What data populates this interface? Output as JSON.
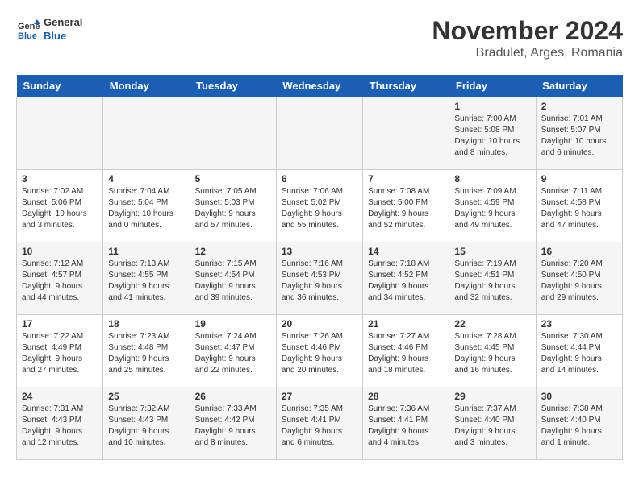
{
  "logo": {
    "line1": "General",
    "line2": "Blue"
  },
  "title": "November 2024",
  "subtitle": "Bradulet, Arges, Romania",
  "days_of_week": [
    "Sunday",
    "Monday",
    "Tuesday",
    "Wednesday",
    "Thursday",
    "Friday",
    "Saturday"
  ],
  "weeks": [
    [
      {
        "day": "",
        "info": ""
      },
      {
        "day": "",
        "info": ""
      },
      {
        "day": "",
        "info": ""
      },
      {
        "day": "",
        "info": ""
      },
      {
        "day": "",
        "info": ""
      },
      {
        "day": "1",
        "info": "Sunrise: 7:00 AM\nSunset: 5:08 PM\nDaylight: 10 hours\nand 8 minutes."
      },
      {
        "day": "2",
        "info": "Sunrise: 7:01 AM\nSunset: 5:07 PM\nDaylight: 10 hours\nand 6 minutes."
      }
    ],
    [
      {
        "day": "3",
        "info": "Sunrise: 7:02 AM\nSunset: 5:06 PM\nDaylight: 10 hours\nand 3 minutes."
      },
      {
        "day": "4",
        "info": "Sunrise: 7:04 AM\nSunset: 5:04 PM\nDaylight: 10 hours\nand 0 minutes."
      },
      {
        "day": "5",
        "info": "Sunrise: 7:05 AM\nSunset: 5:03 PM\nDaylight: 9 hours\nand 57 minutes."
      },
      {
        "day": "6",
        "info": "Sunrise: 7:06 AM\nSunset: 5:02 PM\nDaylight: 9 hours\nand 55 minutes."
      },
      {
        "day": "7",
        "info": "Sunrise: 7:08 AM\nSunset: 5:00 PM\nDaylight: 9 hours\nand 52 minutes."
      },
      {
        "day": "8",
        "info": "Sunrise: 7:09 AM\nSunset: 4:59 PM\nDaylight: 9 hours\nand 49 minutes."
      },
      {
        "day": "9",
        "info": "Sunrise: 7:11 AM\nSunset: 4:58 PM\nDaylight: 9 hours\nand 47 minutes."
      }
    ],
    [
      {
        "day": "10",
        "info": "Sunrise: 7:12 AM\nSunset: 4:57 PM\nDaylight: 9 hours\nand 44 minutes."
      },
      {
        "day": "11",
        "info": "Sunrise: 7:13 AM\nSunset: 4:55 PM\nDaylight: 9 hours\nand 41 minutes."
      },
      {
        "day": "12",
        "info": "Sunrise: 7:15 AM\nSunset: 4:54 PM\nDaylight: 9 hours\nand 39 minutes."
      },
      {
        "day": "13",
        "info": "Sunrise: 7:16 AM\nSunset: 4:53 PM\nDaylight: 9 hours\nand 36 minutes."
      },
      {
        "day": "14",
        "info": "Sunrise: 7:18 AM\nSunset: 4:52 PM\nDaylight: 9 hours\nand 34 minutes."
      },
      {
        "day": "15",
        "info": "Sunrise: 7:19 AM\nSunset: 4:51 PM\nDaylight: 9 hours\nand 32 minutes."
      },
      {
        "day": "16",
        "info": "Sunrise: 7:20 AM\nSunset: 4:50 PM\nDaylight: 9 hours\nand 29 minutes."
      }
    ],
    [
      {
        "day": "17",
        "info": "Sunrise: 7:22 AM\nSunset: 4:49 PM\nDaylight: 9 hours\nand 27 minutes."
      },
      {
        "day": "18",
        "info": "Sunrise: 7:23 AM\nSunset: 4:48 PM\nDaylight: 9 hours\nand 25 minutes."
      },
      {
        "day": "19",
        "info": "Sunrise: 7:24 AM\nSunset: 4:47 PM\nDaylight: 9 hours\nand 22 minutes."
      },
      {
        "day": "20",
        "info": "Sunrise: 7:26 AM\nSunset: 4:46 PM\nDaylight: 9 hours\nand 20 minutes."
      },
      {
        "day": "21",
        "info": "Sunrise: 7:27 AM\nSunset: 4:46 PM\nDaylight: 9 hours\nand 18 minutes."
      },
      {
        "day": "22",
        "info": "Sunrise: 7:28 AM\nSunset: 4:45 PM\nDaylight: 9 hours\nand 16 minutes."
      },
      {
        "day": "23",
        "info": "Sunrise: 7:30 AM\nSunset: 4:44 PM\nDaylight: 9 hours\nand 14 minutes."
      }
    ],
    [
      {
        "day": "24",
        "info": "Sunrise: 7:31 AM\nSunset: 4:43 PM\nDaylight: 9 hours\nand 12 minutes."
      },
      {
        "day": "25",
        "info": "Sunrise: 7:32 AM\nSunset: 4:43 PM\nDaylight: 9 hours\nand 10 minutes."
      },
      {
        "day": "26",
        "info": "Sunrise: 7:33 AM\nSunset: 4:42 PM\nDaylight: 9 hours\nand 8 minutes."
      },
      {
        "day": "27",
        "info": "Sunrise: 7:35 AM\nSunset: 4:41 PM\nDaylight: 9 hours\nand 6 minutes."
      },
      {
        "day": "28",
        "info": "Sunrise: 7:36 AM\nSunset: 4:41 PM\nDaylight: 9 hours\nand 4 minutes."
      },
      {
        "day": "29",
        "info": "Sunrise: 7:37 AM\nSunset: 4:40 PM\nDaylight: 9 hours\nand 3 minutes."
      },
      {
        "day": "30",
        "info": "Sunrise: 7:38 AM\nSunset: 4:40 PM\nDaylight: 9 hours\nand 1 minute."
      }
    ]
  ]
}
